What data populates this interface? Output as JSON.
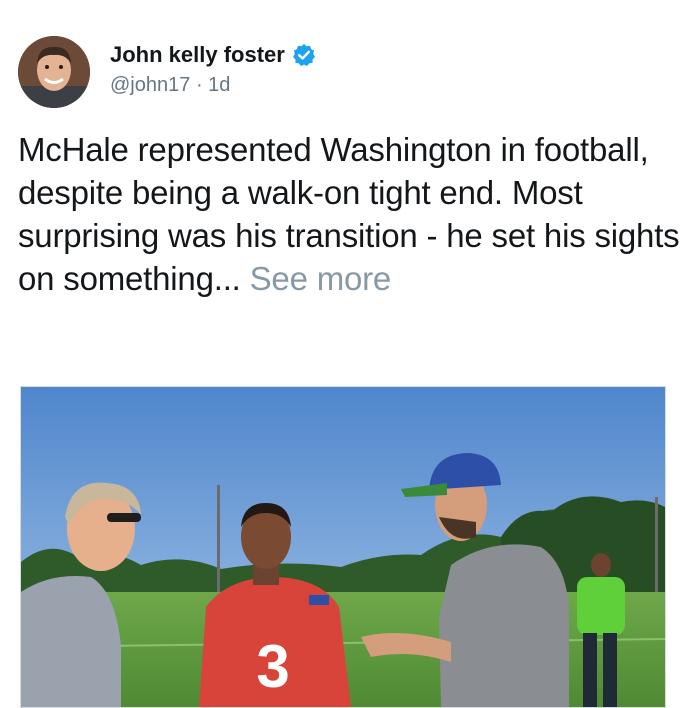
{
  "tweet": {
    "author": {
      "display_name": "John kelly foster",
      "handle": "@john17",
      "separator": "·",
      "age": "1d",
      "verified": true,
      "avatar_icon": "profile-photo"
    },
    "text": "McHale represented Washington in football, despite being a walk-on tight end. Most surprising was his transition - he set his sights on something...",
    "see_more_label": "See more",
    "media": {
      "kind": "photo",
      "jersey_number": "3"
    }
  },
  "colors": {
    "verified_badge": "#1da1f2",
    "see_more": "#8899a6",
    "handle": "#657786",
    "sky": "#6f9fd8",
    "field": "#5e9a3e",
    "jersey": "#d9443a",
    "cap": "#2e4fa8"
  }
}
